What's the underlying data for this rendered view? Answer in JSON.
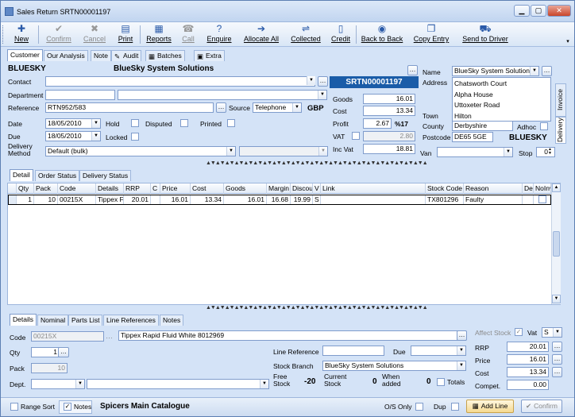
{
  "window": {
    "title": "Sales Return SRTN00001197"
  },
  "toolbar": {
    "items": [
      {
        "label": "New",
        "icon": "plus-icon",
        "glyph": "✚",
        "enabled": true
      },
      {
        "label": "Confirm",
        "icon": "check-icon",
        "glyph": "✔",
        "enabled": false
      },
      {
        "label": "Cancel",
        "icon": "x-icon",
        "glyph": "✖",
        "enabled": false
      },
      {
        "label": "Print",
        "icon": "printer-icon",
        "glyph": "▤",
        "enabled": true
      },
      {
        "label": "Reports",
        "icon": "reports-icon",
        "glyph": "▦",
        "enabled": true
      },
      {
        "label": "Call",
        "icon": "phone-icon",
        "glyph": "☎",
        "enabled": false
      },
      {
        "label": "Enquire",
        "icon": "question-icon",
        "glyph": "?",
        "enabled": true
      },
      {
        "label": "Allocate All",
        "icon": "arrow-icon",
        "glyph": "➔",
        "enabled": true
      },
      {
        "label": "Collected",
        "icon": "collected-icon",
        "glyph": "⇌",
        "enabled": true
      },
      {
        "label": "Credit",
        "icon": "document-icon",
        "glyph": "▯",
        "enabled": true
      },
      {
        "label": "Back to Back",
        "icon": "back-to-back-icon",
        "glyph": "◉",
        "enabled": true
      },
      {
        "label": "Copy Entry",
        "icon": "copy-icon",
        "glyph": "❐",
        "enabled": true
      },
      {
        "label": "Send to Driver",
        "icon": "truck-icon",
        "glyph": "⛟",
        "enabled": true
      }
    ]
  },
  "top_tabs": [
    "Customer",
    "Our Analysis",
    "Note",
    "Audit",
    "Batches",
    "Extra"
  ],
  "customer": {
    "code": "BLUESKY",
    "name": "BlueSky System Solutions",
    "contact": "",
    "department": "",
    "reference": "RTN952/583",
    "source": "Telephone",
    "currency": "GBP",
    "date": "18/05/2010",
    "due": "18/05/2010",
    "delivery_method": "Default (bulk)"
  },
  "labels": {
    "contact": "Contact",
    "department": "Department",
    "reference": "Reference",
    "source": "Source",
    "date": "Date",
    "due": "Due",
    "delivery": "Delivery",
    "method": "Method",
    "hold": "Hold",
    "disputed": "Disputed",
    "printed": "Printed",
    "locked": "Locked",
    "goods": "Goods",
    "cost": "Cost",
    "profit": "Profit",
    "vat": "VAT",
    "inc_vat": "Inc Vat",
    "name": "Name",
    "address": "Address",
    "town": "Town",
    "county": "County",
    "postcode": "Postcode",
    "adhoc": "Adhoc",
    "van": "Van",
    "stop": "Stop"
  },
  "totals": {
    "doc_no": "SRTN00001197",
    "goods": "16.01",
    "cost": "13.34",
    "profit": "2.67",
    "profit_pct": "%17",
    "vat": "2.80",
    "inc_vat": "18.81"
  },
  "address": {
    "name": "BlueSky System Solution",
    "lines": [
      "Chatsworth Court",
      "Alpha House",
      "Uttoxeter Road",
      "Hilton"
    ],
    "town": "Hilton",
    "county": "Derbyshire",
    "postcode": "DE65 5GE",
    "code": "BLUESKY",
    "stop": "0"
  },
  "side_tabs": [
    "Invoice",
    "Delivery"
  ],
  "mid_tabs": [
    "Detail",
    "Order Status",
    "Delivery Status"
  ],
  "lines": {
    "headers": [
      "Qty",
      "Pack",
      "Code",
      "Details",
      "RRP",
      "C",
      "Price",
      "Cost",
      "Goods",
      "Margin",
      "Discou",
      "V",
      "Link",
      "Stock Code",
      "Reason",
      "De",
      "NoInv"
    ],
    "rows": [
      {
        "qty": "1",
        "pack": "10",
        "code": "00215X",
        "details": "Tippex F",
        "rrp": "20.01",
        "c": "",
        "price": "16.01",
        "cost": "13.34",
        "goods": "16.01",
        "margin": "16.68",
        "discount": "19.99",
        "v": "S",
        "link": "",
        "stock_code": "TX801296",
        "reason": "Faulty",
        "de": ""
      }
    ]
  },
  "bottom_tabs": [
    "Details",
    "Nominal",
    "Parts List",
    "Line References",
    "Notes"
  ],
  "details": {
    "code": "00215X",
    "description": "Tippex Rapid Fluid White 8012969",
    "qty": "1",
    "pack": "10",
    "dept": "",
    "line_ref": "",
    "due": "",
    "stock_branch": "BlueSky System Solutions",
    "free_stock": "-20",
    "current_stock": "0",
    "when_added": "0",
    "rrp": "20.01",
    "price": "16.01",
    "cost": "13.34",
    "compet": "0.00",
    "vat_code": "S"
  },
  "detail_labels": {
    "code": "Code",
    "qty": "Qty",
    "pack": "Pack",
    "dept": "Dept.",
    "line_ref": "Line Reference",
    "due": "Due",
    "stock_branch": "Stock Branch",
    "free_stock": "Free Stock",
    "current_stock": "Current Stock",
    "when_added": "When added",
    "totals": "Totals",
    "affect_stock": "Affect Stock",
    "vat": "Vat",
    "rrp": "RRP",
    "price": "Price",
    "cost": "Cost",
    "compet": "Compet."
  },
  "statusbar": {
    "range_sort": "Range Sort",
    "notes": "Notes",
    "catalogue": "Spicers Main Catalogue",
    "os_only": "O/S Only",
    "dup": "Dup",
    "add_line": "Add Line",
    "confirm": "Confirm"
  }
}
